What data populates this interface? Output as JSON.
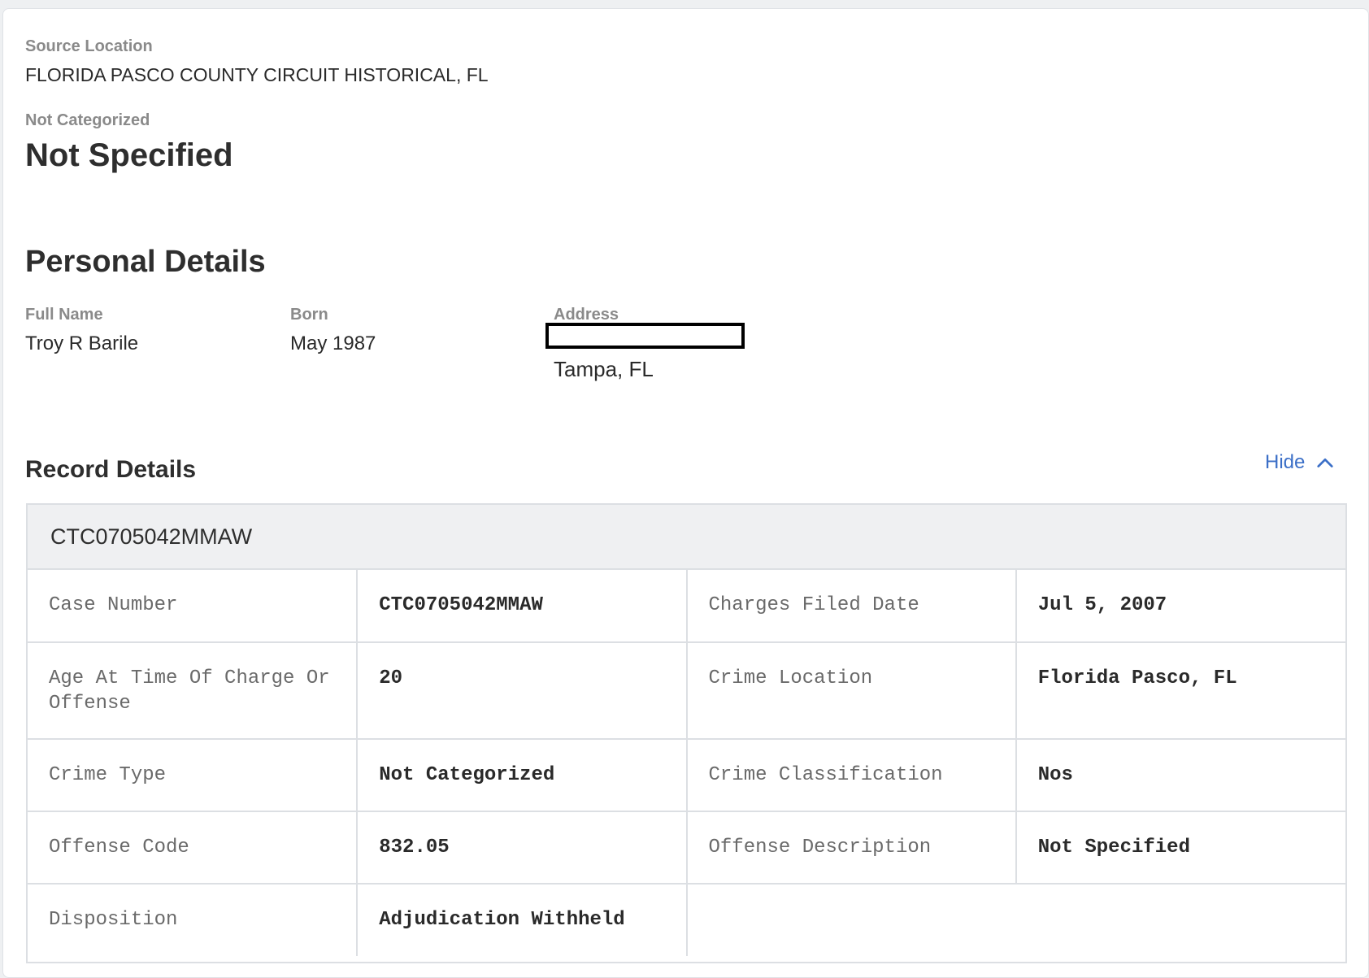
{
  "source": {
    "label": "Source Location",
    "value": "FLORIDA PASCO COUNTY CIRCUIT HISTORICAL, FL"
  },
  "category": {
    "label": "Not Categorized",
    "value": "Not Specified"
  },
  "personal": {
    "heading": "Personal Details",
    "full_name_label": "Full Name",
    "full_name": "Troy R Barile",
    "born_label": "Born",
    "born": "May 1987",
    "address_label": "Address",
    "address_city": "Tampa, FL"
  },
  "record": {
    "heading": "Record Details",
    "hide_label": "Hide",
    "header": "CTC0705042MMAW",
    "rows": [
      {
        "k1": "Case Number",
        "v1": "CTC0705042MMAW",
        "k2": "Charges Filed Date",
        "v2": "Jul 5, 2007"
      },
      {
        "k1": "Age At Time Of Charge Or Offense",
        "v1": "20",
        "k2": "Crime Location",
        "v2": "Florida Pasco, FL"
      },
      {
        "k1": "Crime Type",
        "v1": "Not Categorized",
        "k2": "Crime Classification",
        "v2": "Nos"
      },
      {
        "k1": "Offense Code",
        "v1": "832.05",
        "k2": "Offense Description",
        "v2": "Not Specified"
      },
      {
        "k1": "Disposition",
        "v1": "Adjudication Withheld"
      }
    ]
  },
  "icons": {
    "hide": "chevron-up-icon"
  },
  "colors": {
    "accent": "#3b6fc7",
    "muted": "#8a8a8a",
    "border": "#dcdfe3",
    "header_bg": "#eff0f2"
  }
}
